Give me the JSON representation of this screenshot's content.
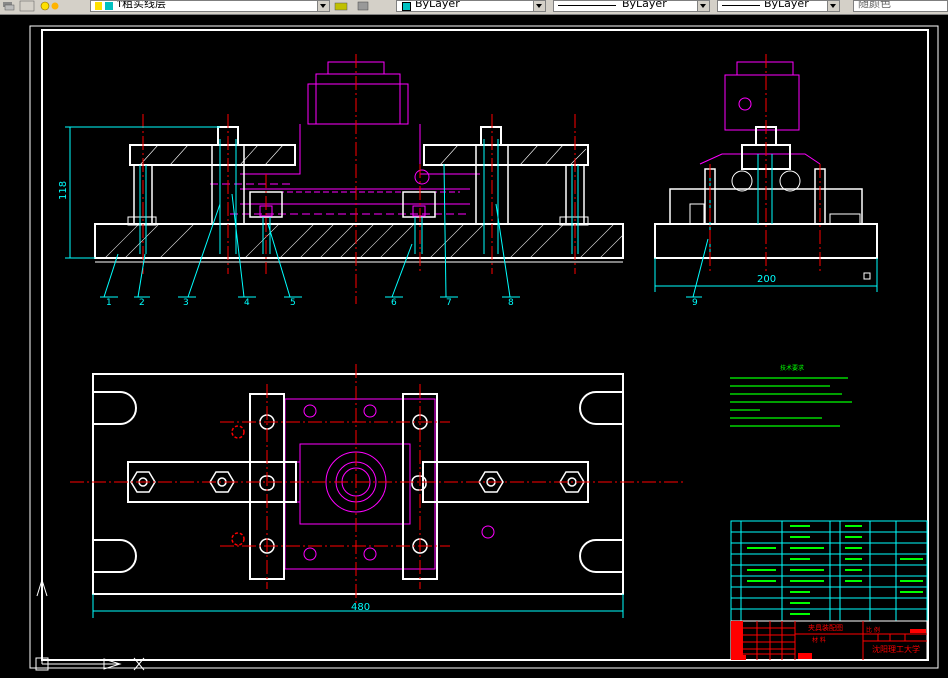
{
  "toolbar": {
    "layer_name": "粗实线层",
    "layer_prefix": "↑",
    "color": "ByLayer",
    "linetype": "ByLayer",
    "lineweight": "ByLayer",
    "plotstyle": "随颜色"
  },
  "dimensions": {
    "height_front": "118",
    "width_side": "200",
    "width_top": "480"
  },
  "balloons": [
    "1",
    "2",
    "3",
    "4",
    "5",
    "6",
    "7",
    "8",
    "9"
  ],
  "tech_title": "技术要求",
  "title_block": {
    "drawing_name": "夹具装配图",
    "school": "沈阳理工大学",
    "material": "材 料",
    "scale_label": "比 例"
  },
  "colors": {
    "object": "#ffffff",
    "center": "#ff0000",
    "hidden": "#ff00ff",
    "dimension": "#00ffff",
    "note": "#00ff00"
  },
  "icons": [
    "layer-state-icon",
    "layer-props-icon",
    "lightbulb-icon",
    "sun-icon",
    "lock-icon",
    "make-current-icon",
    "layer-previous-icon",
    "ucs-icon"
  ]
}
